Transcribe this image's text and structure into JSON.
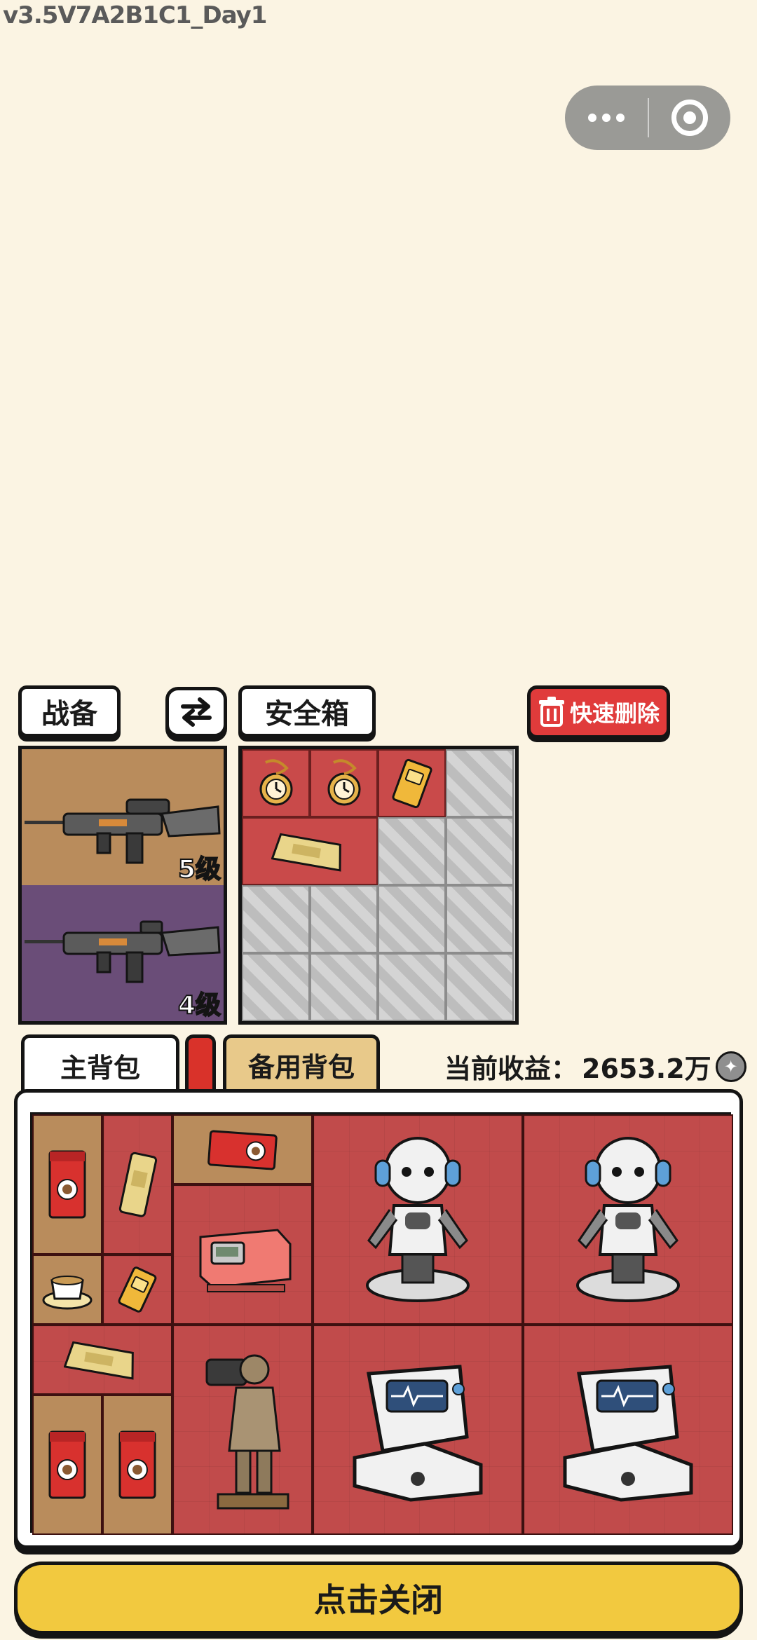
{
  "version_label": "v3.5V7A2B1C1_Day1",
  "capsule": {
    "more_icon": "more-dots-icon",
    "close_icon": "target-circle-icon"
  },
  "toolbar": {
    "gear_label": "战备",
    "swap_icon": "swap-arrows-icon",
    "safebox_label": "安全箱",
    "quick_delete_label": "快速删除"
  },
  "weapons": [
    {
      "name": "rifle",
      "level": "5级",
      "bg": "#b98c5c"
    },
    {
      "name": "rifle",
      "level": "4级",
      "bg": "#6a4d78"
    }
  ],
  "tabs": {
    "main_bag": "主背包",
    "spare_bag": "备用背包"
  },
  "income": {
    "label": "当前收益：",
    "value": "2653.2万"
  },
  "close_button": "点击关闭",
  "colors": {
    "background": "#fbf4e3",
    "cell_red": "#c14b4b",
    "cell_tan": "#b98c5c",
    "close_button": "#f2c93f",
    "delete_button": "#e03b3b"
  }
}
